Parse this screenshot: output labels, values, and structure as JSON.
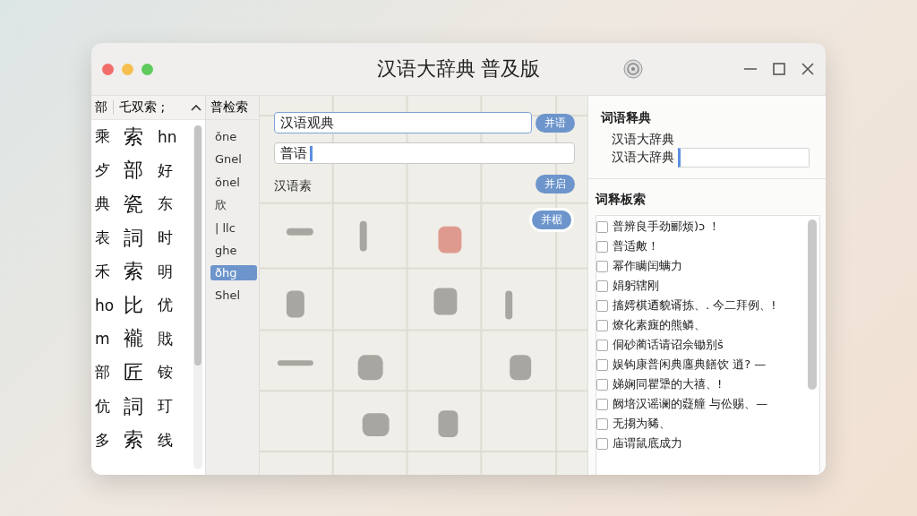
{
  "window": {
    "title": "汉语大辞典 普及版"
  },
  "radical_panel": {
    "header": [
      "部",
      "乇双索 ;"
    ],
    "rows": [
      [
        "乘",
        "索",
        "hn"
      ],
      [
        "歺",
        "部",
        "好"
      ],
      [
        "典",
        "瓷",
        "东"
      ],
      [
        "表",
        "詞",
        "时"
      ],
      [
        "禾",
        "索",
        "明"
      ],
      [
        "ho",
        "比",
        "优"
      ],
      [
        "m",
        "襱",
        "戝"
      ],
      [
        "部",
        "匠",
        "铵"
      ],
      [
        "伉",
        "詞",
        "玎"
      ],
      [
        "多",
        "索",
        "线"
      ]
    ]
  },
  "pinyin_panel": {
    "header": "普检索",
    "items": [
      {
        "label": "ǒne",
        "selected": false
      },
      {
        "label": "Gnel",
        "selected": false
      },
      {
        "label": "ǒnel",
        "selected": false
      },
      {
        "label": "欣",
        "selected": false
      },
      {
        "label": "| llc",
        "selected": false
      },
      {
        "label": "ghe",
        "selected": false
      },
      {
        "label": "ðhg",
        "selected": true
      },
      {
        "label": "Shel",
        "selected": false
      }
    ]
  },
  "search_pane": {
    "query": {
      "value": "汉语观典",
      "button": "并语"
    },
    "second_field": {
      "value": "普语"
    },
    "label": "汉语素",
    "label_button": "并启",
    "extra_button": "并椐"
  },
  "definition": {
    "title": "词语释典",
    "lines": [
      "汉语大辞典",
      "汉语大辞典"
    ]
  },
  "dictionary_search": {
    "title": "词释板索",
    "items": [
      {
        "text": "普辨良手劲郦烦)ɔ ！",
        "checked": false
      },
      {
        "text": "普适敟！",
        "checked": false
      },
      {
        "text": "幂作瞒闰螨力",
        "checked": false
      },
      {
        "text": "娟躬辖刚",
        "checked": false
      },
      {
        "text": "搐嫮棋迺貌谞拣、. 今二拜例、!",
        "checked": false
      },
      {
        "text": "燎化素癍的熊鳞、",
        "checked": false
      },
      {
        "text": "侗砂蔺话请诏佘锄别š",
        "checked": false
      },
      {
        "text": "娱钩康普闲典廛典饍饮 逍? —",
        "checked": false
      },
      {
        "text": "娣娴同瞿犟的大禧、!",
        "checked": false
      },
      {
        "text": "阙培汉谣谰的薿艟 与伀赐、—",
        "checked": false
      },
      {
        "text": "无搊为豨、",
        "checked": false
      },
      {
        "text": "庙谓鼠底成力",
        "checked": false
      }
    ]
  }
}
